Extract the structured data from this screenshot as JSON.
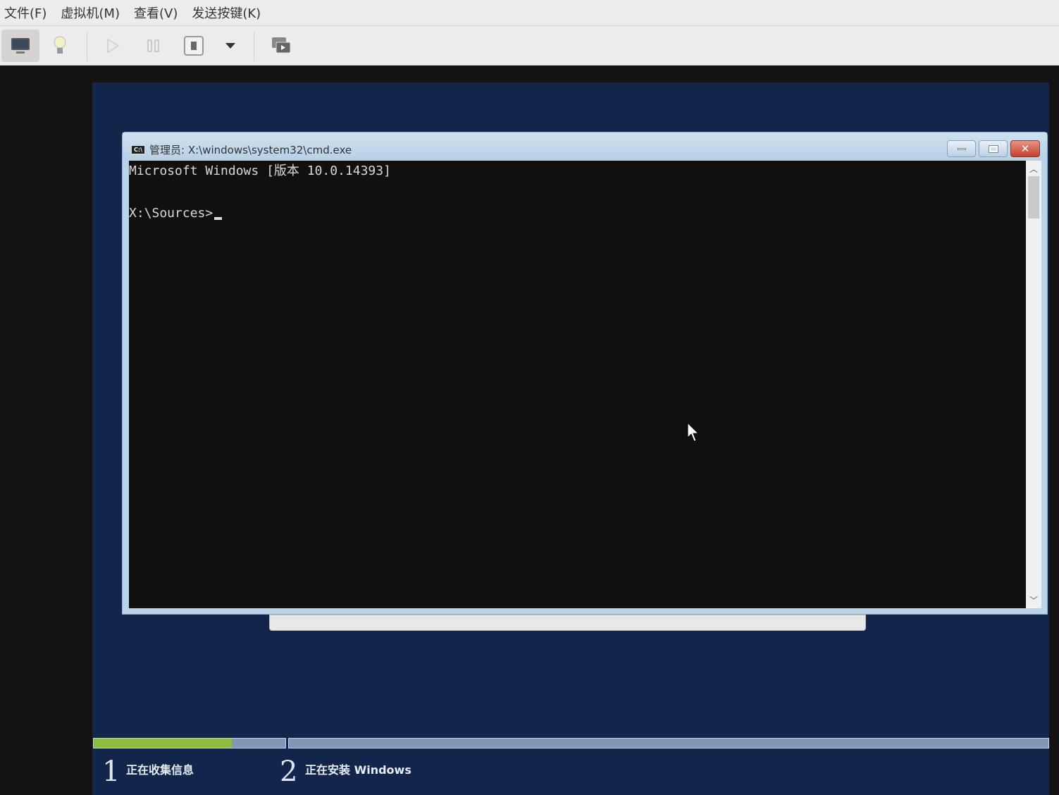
{
  "menu": [
    "文件(F)",
    "虚拟机(M)",
    "查看(V)",
    "发送按键(K)"
  ],
  "cmd": {
    "title": "管理员: X:\\windows\\system32\\cmd.exe",
    "icon_text": "C:\\",
    "lines": [
      "Microsoft Windows [版本 10.0.14393]",
      "X:\\Sources>"
    ]
  },
  "setup": {
    "step1_num": "1",
    "step1_label": "正在收集信息",
    "step2_num": "2",
    "step2_label": "正在安装 Windows",
    "progress_step1": 0.72,
    "progress_step2": 0
  },
  "colors": {
    "progress": "#8cbf3f",
    "setup_bg": "#12264b"
  }
}
